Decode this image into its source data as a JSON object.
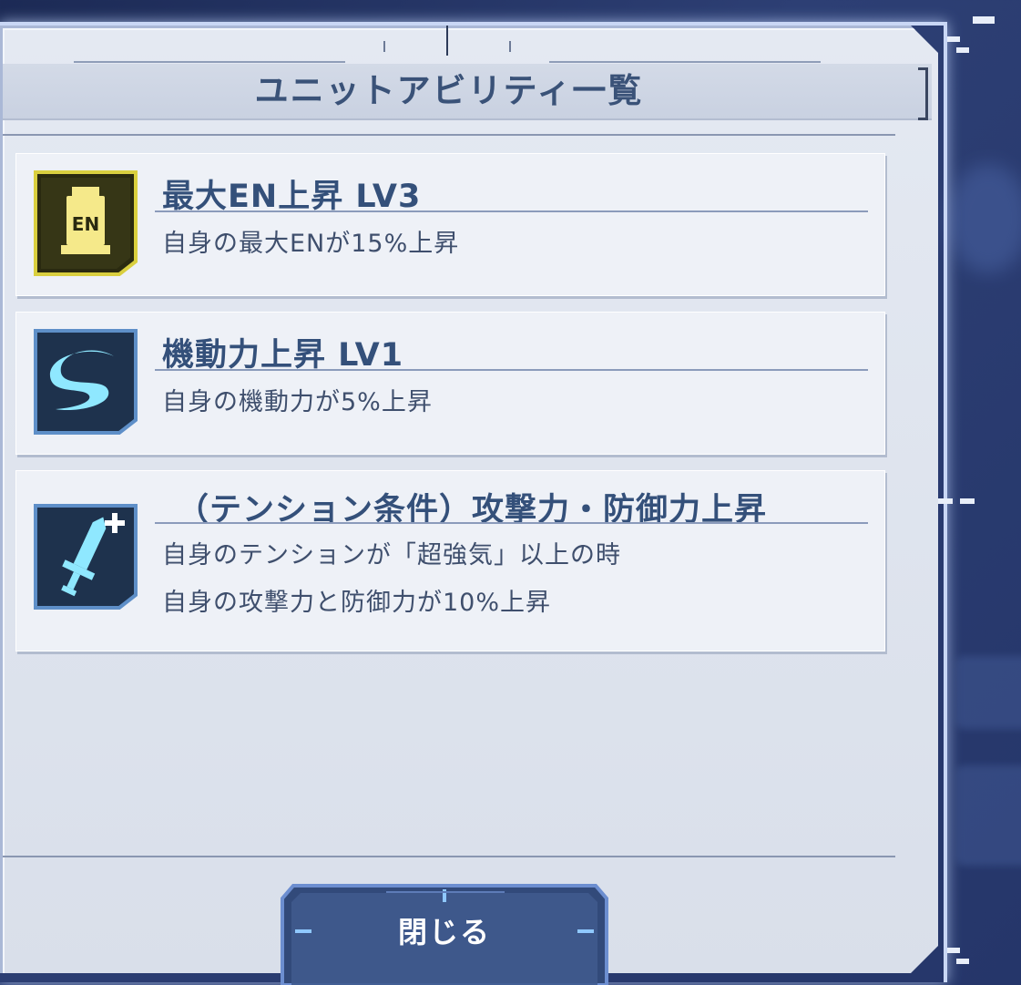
{
  "dialog": {
    "title": "ユニットアビリティ一覧",
    "close_label": "閉じる"
  },
  "abilities": [
    {
      "name": "最大EN上昇 LV3",
      "icon": "en-tank-icon",
      "icon_text": "EN",
      "icon_color": "#e8e07a",
      "description": [
        "自身の最大ENが15%上昇"
      ]
    },
    {
      "name": "機動力上昇 LV1",
      "icon": "mobility-swoosh-icon",
      "icon_color": "#7fe6ff",
      "description": [
        "自身の機動力が5%上昇"
      ]
    },
    {
      "name": "（テンション条件）攻撃力・防御力上昇",
      "icon": "sword-plus-icon",
      "icon_color": "#7fe6ff",
      "description": [
        "自身のテンションが「超強気」以上の時",
        "自身の攻撃力と防御力が10%上昇"
      ]
    }
  ],
  "colors": {
    "title": "#3a5278",
    "card_title": "#34507a",
    "card_desc": "#3f4f6d",
    "icon_gold_bg": "#2f2f12",
    "icon_blue_bg": "#1f3550"
  }
}
